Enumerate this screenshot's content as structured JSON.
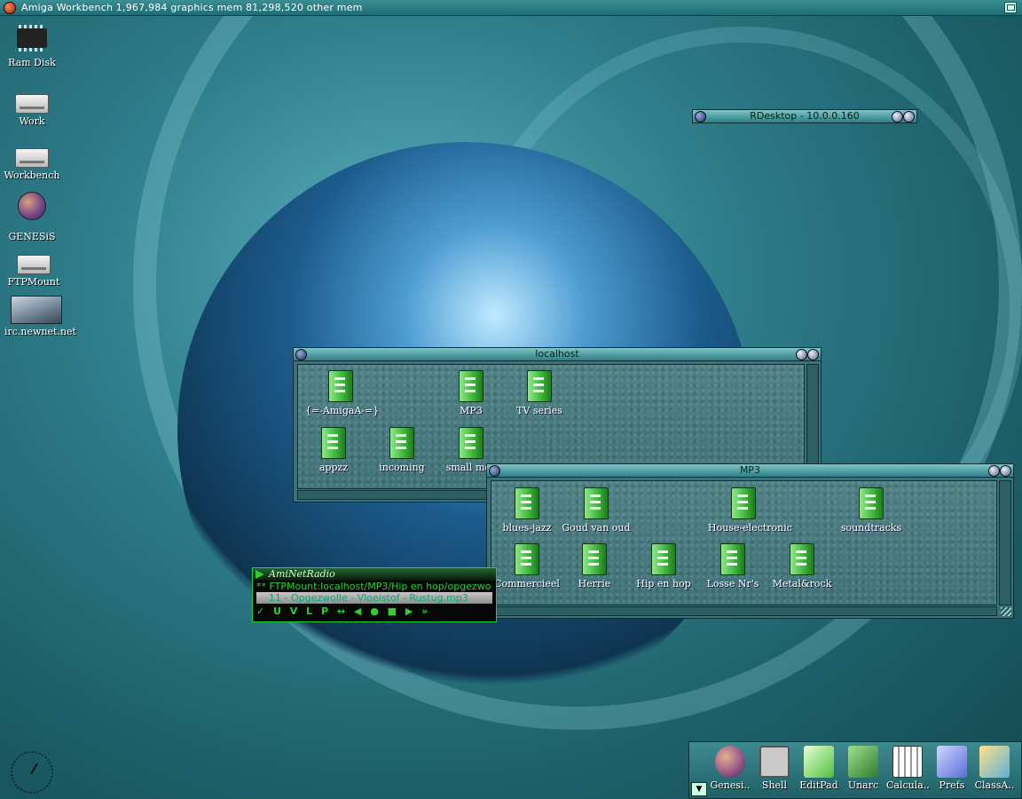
{
  "menubar": {
    "title": "Amiga Workbench  1,967,984 graphics mem  81,298,520 other mem"
  },
  "desktop_icons": [
    {
      "label": "Ram Disk",
      "icon": "chip-icon"
    },
    {
      "label": "Work",
      "icon": "drive-icon"
    },
    {
      "label": "Workbench",
      "icon": "drive-icon"
    },
    {
      "label": "GENESiS",
      "icon": "globe-icon"
    },
    {
      "label": "FTPMount",
      "icon": "drive-icon"
    },
    {
      "label": "irc.newnet.net",
      "icon": "photo-icon"
    }
  ],
  "rdesktop": {
    "title": "RDesktop - 10.0.0.160"
  },
  "localhost": {
    "title": "localhost",
    "items": [
      "{=-AmigaA-=}",
      "MP3",
      "TV series",
      "appzz",
      "incoming",
      "small mov"
    ]
  },
  "mp3": {
    "title": "MP3",
    "items": [
      "blues-jazz",
      "Goud van oud",
      "House-electronic",
      "soundtracks",
      "Commercieel",
      "Herrie",
      "Hip en hop",
      "Losse Nr's",
      "Metal&rock"
    ]
  },
  "radio": {
    "title": "AmiNetRadio",
    "url": "** FTPMount:localhost/MP3/Hip en hop/opgezwo",
    "track": "11 - Opgezwolle - Vloeistof - Rustug.mp3",
    "controls": "✓ U V L P ↔  ◀ ● ■ ▶ »"
  },
  "dock": {
    "items": [
      "Genesi..",
      "Shell",
      "EditPad",
      "Unarc",
      "Calcula..",
      "Prefs",
      "ClassA.."
    ],
    "colors": [
      "#9a5a8c",
      "#c9c9c9",
      "#4fbf3c",
      "#5aa84a",
      "#d6d6d6",
      "#5a6bd6",
      "#e0c24a"
    ]
  }
}
